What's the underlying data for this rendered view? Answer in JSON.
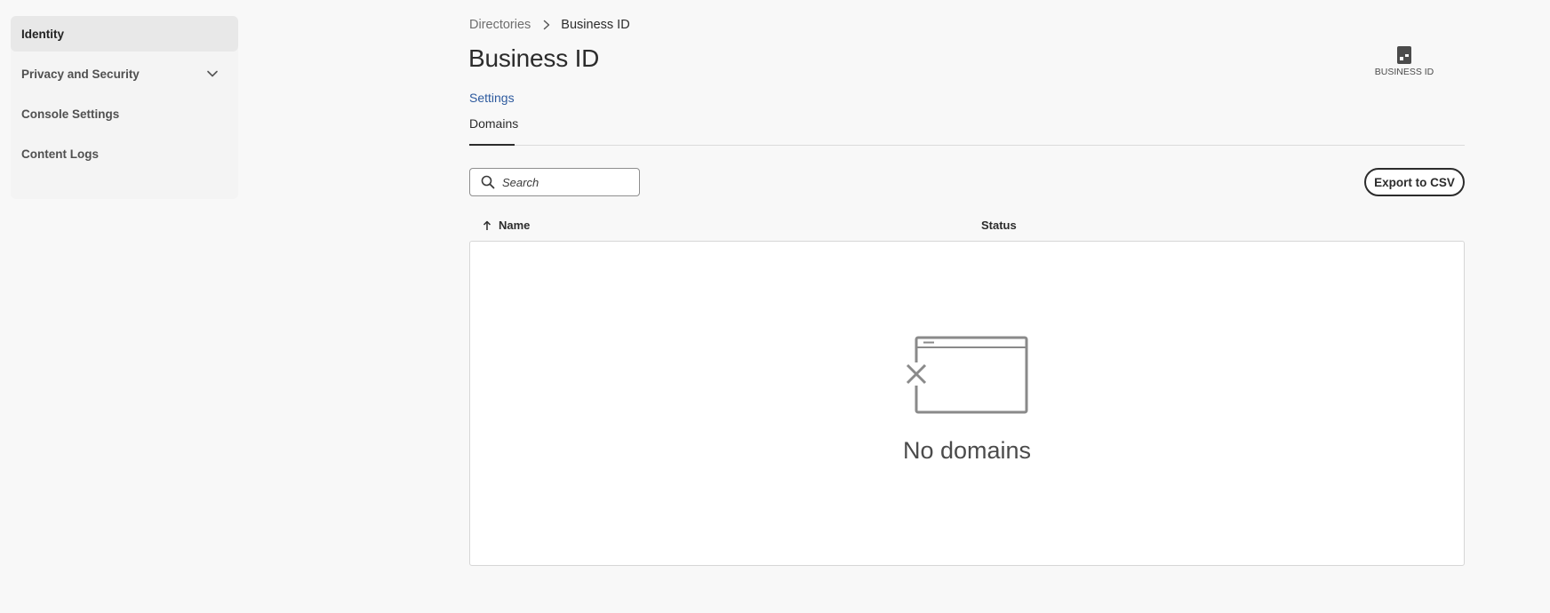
{
  "sidebar": {
    "items": [
      {
        "label": "Identity",
        "active": true
      },
      {
        "label": "Privacy and Security",
        "expandable": true
      },
      {
        "label": "Console Settings"
      },
      {
        "label": "Content Logs"
      }
    ]
  },
  "breadcrumb": {
    "parent": "Directories",
    "current": "Business ID"
  },
  "page": {
    "title": "Business ID",
    "badge_label": "BUSINESS ID",
    "badge_icon": "business-id-icon"
  },
  "tabs": {
    "settings": "Settings",
    "domains": "Domains",
    "selected": "Domains"
  },
  "toolbar": {
    "search_placeholder": "Search",
    "search_value": "",
    "export_label": "Export to CSV"
  },
  "table": {
    "columns": [
      "Name",
      "Status"
    ],
    "sort": {
      "column": "Name",
      "direction": "ascending"
    },
    "rows": [],
    "empty_message": "No domains"
  },
  "colors": {
    "background": "#f8f8f8",
    "link": "#2d5a9e",
    "text": "#2c2c2c",
    "border": "#d6d6d6"
  }
}
